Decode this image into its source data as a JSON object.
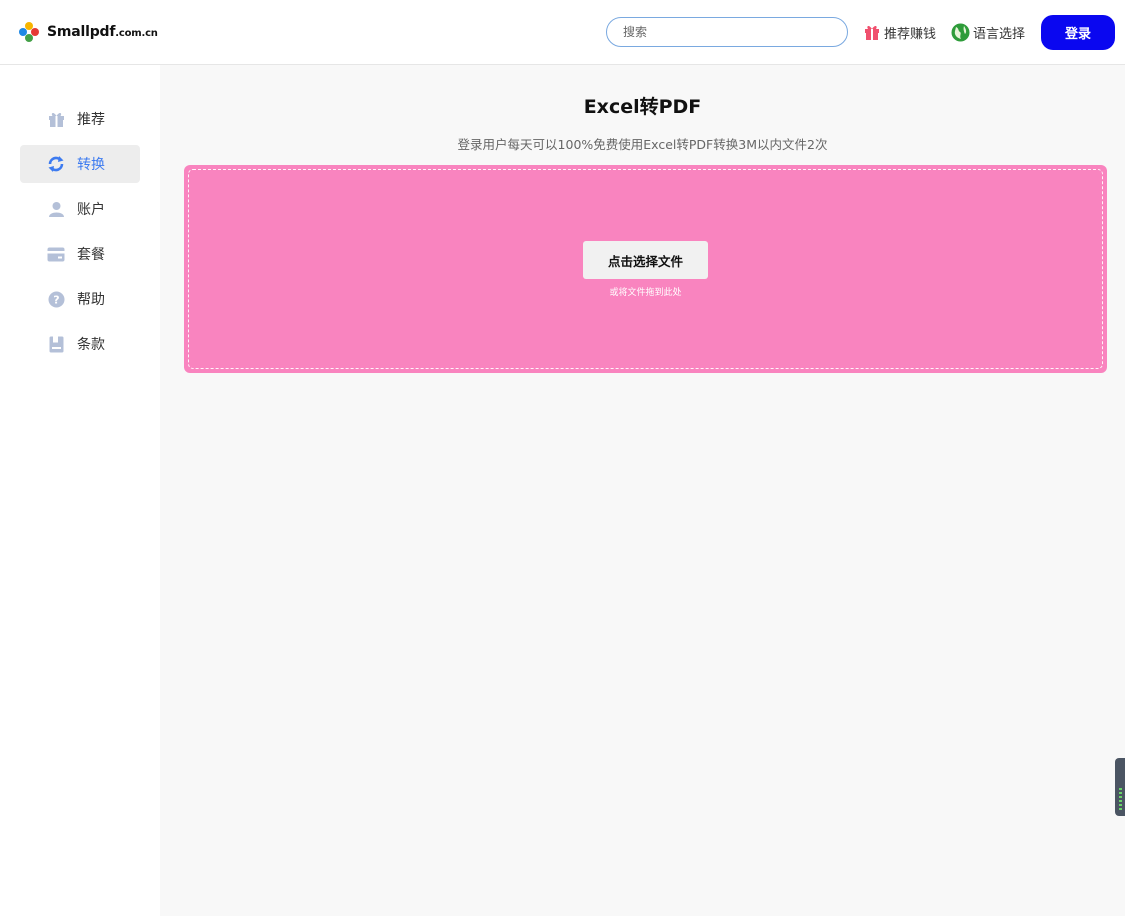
{
  "header": {
    "logo_text": "Smallpdf",
    "logo_suffix": ".com.cn",
    "search_placeholder": "搜索",
    "referral_label": "推荐赚钱",
    "language_label": "语言选择",
    "login_label": "登录",
    "icons": {
      "referral": "gift-icon",
      "language": "globe-icon"
    }
  },
  "sidebar": {
    "items": [
      {
        "label": "推荐",
        "icon": "gift-icon",
        "active": false
      },
      {
        "label": "转换",
        "icon": "convert-icon",
        "active": true
      },
      {
        "label": "账户",
        "icon": "user-icon",
        "active": false
      },
      {
        "label": "套餐",
        "icon": "card-icon",
        "active": false
      },
      {
        "label": "帮助",
        "icon": "help-icon",
        "active": false
      },
      {
        "label": "条款",
        "icon": "document-icon",
        "active": false
      }
    ]
  },
  "main": {
    "title": "Excel转PDF",
    "subtitle": "登录用户每天可以100%免费使用Excel转PDF转换3M以内文件2次",
    "upload_button": "点击选择文件",
    "drop_hint": "或将文件拖到此处"
  },
  "colors": {
    "accent": "#0a07f0",
    "active_nav": "#3d7bf0",
    "dropzone": "#f984bf",
    "main_bg": "#f8f8f8"
  }
}
